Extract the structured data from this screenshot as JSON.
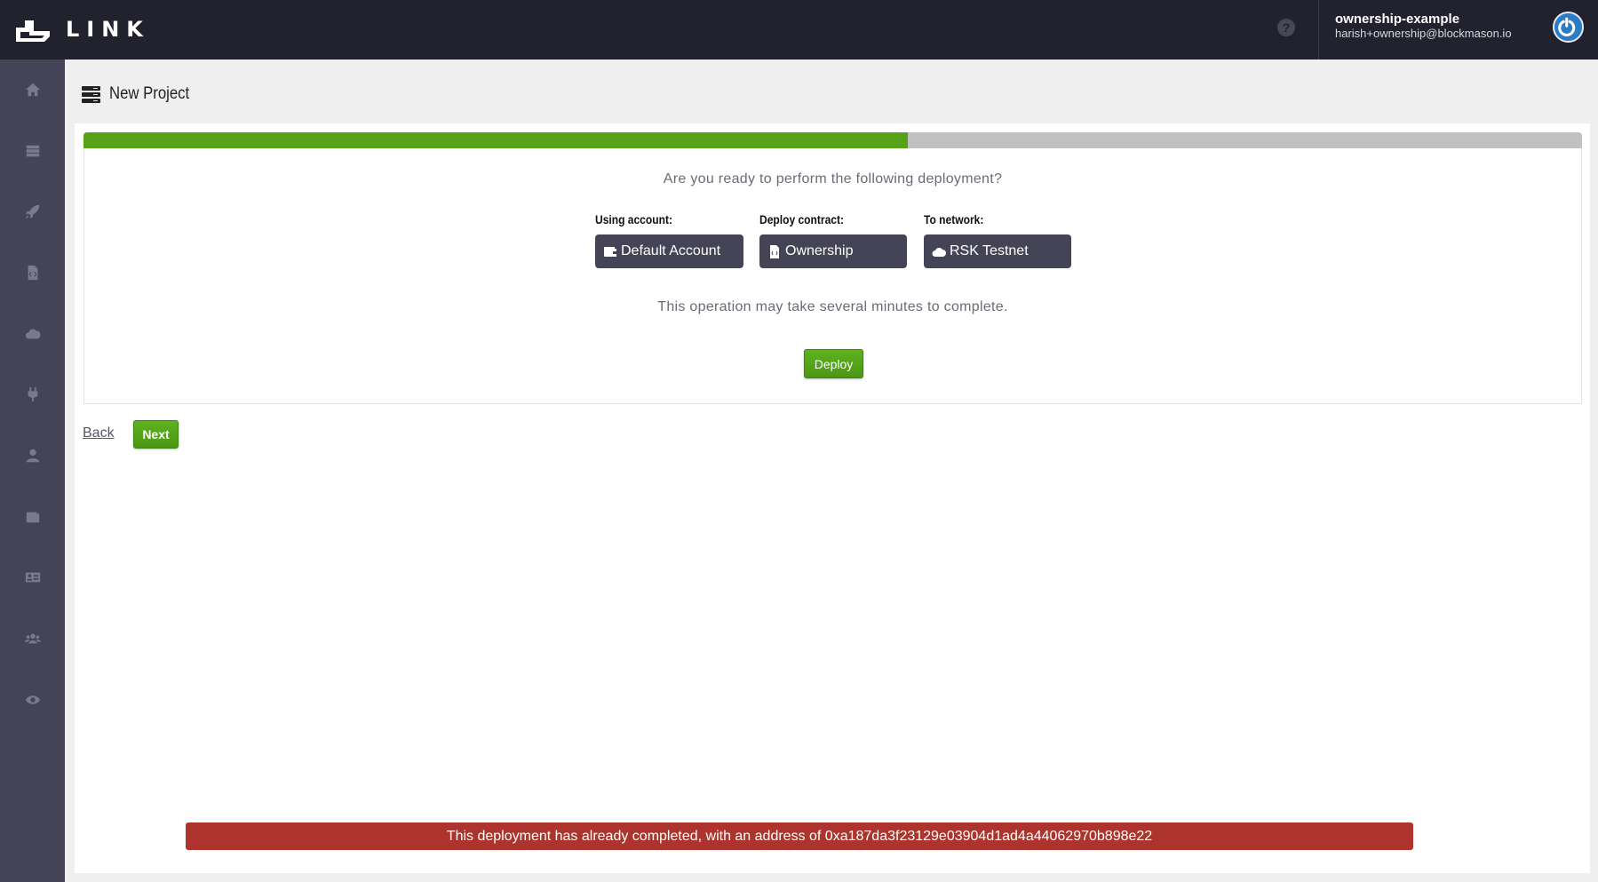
{
  "header": {
    "logo_text": "LINK",
    "help_icon": "question-circle-icon",
    "user": {
      "name": "ownership-example",
      "email": "harish+ownership@blockmason.io"
    },
    "power_icon": "power-icon"
  },
  "sidebar": {
    "items": [
      {
        "icon": "home-icon"
      },
      {
        "icon": "list-icon"
      },
      {
        "icon": "rocket-icon"
      },
      {
        "icon": "code-file-icon"
      },
      {
        "icon": "cloud-icon"
      },
      {
        "icon": "plug-icon"
      },
      {
        "icon": "user-icon"
      },
      {
        "icon": "wallet-icon"
      },
      {
        "icon": "id-card-icon"
      },
      {
        "icon": "users-icon"
      },
      {
        "icon": "eye-icon"
      }
    ]
  },
  "page": {
    "title": "New Project",
    "title_icon": "server-icon"
  },
  "progress": {
    "percent": 55,
    "fill_color": "#55a117",
    "track_color": "#c1c1c4"
  },
  "deployment": {
    "question": "Are you ready to perform the following deployment?",
    "fields": [
      {
        "label": "Using account:",
        "value": "Default Account",
        "icon": "wallet-icon"
      },
      {
        "label": "Deploy contract:",
        "value": "Ownership",
        "icon": "code-file-icon"
      },
      {
        "label": "To network:",
        "value": "RSK Testnet",
        "icon": "cloud-icon"
      }
    ],
    "note": "This operation may take several minutes to complete.",
    "deploy_label": "Deploy"
  },
  "nav": {
    "back_label": "Back",
    "next_label": "Next"
  },
  "alert": {
    "text": "This deployment has already completed, with an address of 0xa187da3f23129e03904d1ad4a44062970b898e22",
    "color": "#ad342d"
  }
}
